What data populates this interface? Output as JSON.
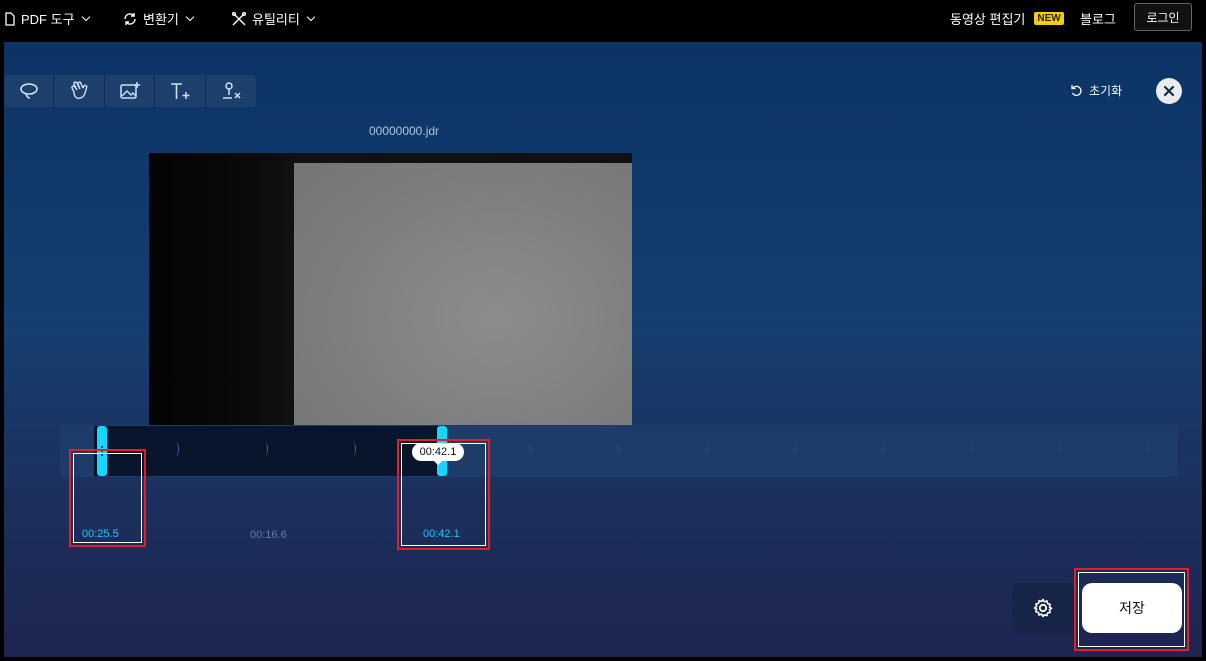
{
  "nav": {
    "pdf_tools": "PDF 도구",
    "converter": "변환기",
    "utilities": "유틸리티",
    "video_editor": "동영상 편집기",
    "new_badge": "NEW",
    "blog": "블로그",
    "login": "로그인"
  },
  "toolbar": {
    "tools": [
      {
        "icon": "lasso-icon"
      },
      {
        "icon": "hand-wave-icon"
      },
      {
        "icon": "add-image-icon"
      },
      {
        "icon": "add-text-icon"
      },
      {
        "icon": "remove-signature-icon"
      }
    ],
    "reset_label": "초기화"
  },
  "video": {
    "filename": "00000000.jdr"
  },
  "timeline": {
    "start_time": "00:25.5",
    "mid_time": "00:16.6",
    "end_time": "00:42.1",
    "tooltip_time": "00:42.1"
  },
  "actions": {
    "save_label": "저장"
  },
  "colors": {
    "accent": "#16d6ff",
    "highlight": "#e31e24",
    "new_badge": "#f5d000"
  }
}
